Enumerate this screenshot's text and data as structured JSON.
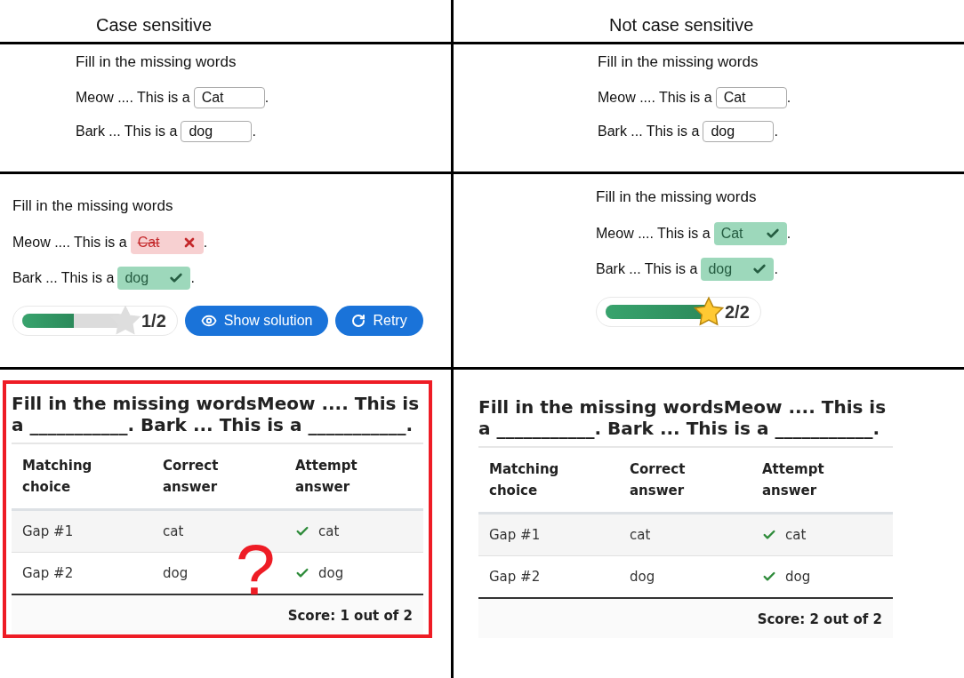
{
  "columns": [
    {
      "heading": "Case sensitive",
      "input_task": {
        "title": "Fill in the missing words",
        "sentences": [
          {
            "text": "Meow .... This is a",
            "value": "Cat",
            "after": "."
          },
          {
            "text": "Bark ... This is a",
            "value": "dog",
            "after": "."
          }
        ]
      },
      "result_task": {
        "title": "Fill in the missing words",
        "sentences": [
          {
            "text": "Meow .... This is a",
            "answer": "Cat",
            "correct": false,
            "after": "."
          },
          {
            "text": "Bark ... This is a",
            "answer": "dog",
            "correct": true,
            "after": "."
          }
        ],
        "progress": {
          "level": 0.5,
          "star_filled": false,
          "score": "1/2"
        },
        "buttons": [
          {
            "label": "Show solution",
            "kind": "solution"
          },
          {
            "label": "Retry",
            "kind": "retry"
          }
        ]
      },
      "report": {
        "highlighted": true,
        "annotation": "?",
        "question": "Fill in the missing wordsMeow .... This is a ___________. Bark ... This is a ___________.",
        "table_columns": [
          "Matching choice",
          "Correct answer",
          "Attempt answer"
        ],
        "rows": [
          {
            "gap": "Gap #1",
            "correct_answer": "cat",
            "attempt": "cat",
            "correct": true
          },
          {
            "gap": "Gap #2",
            "correct_answer": "dog",
            "attempt": "dog",
            "correct": true
          }
        ],
        "score": "Score: 1 out of 2"
      }
    },
    {
      "heading": "Not case sensitive",
      "input_task": {
        "title": "Fill in the missing words",
        "sentences": [
          {
            "text": "Meow .... This is a",
            "value": "Cat",
            "after": "."
          },
          {
            "text": "Bark ... This is a",
            "value": "dog",
            "after": "."
          }
        ]
      },
      "result_task": {
        "title": "Fill in the missing words",
        "sentences": [
          {
            "text": "Meow .... This is a",
            "answer": "Cat",
            "correct": true,
            "after": "."
          },
          {
            "text": "Bark ... This is a",
            "answer": "dog",
            "correct": true,
            "after": "."
          }
        ],
        "progress": {
          "level": 1,
          "star_filled": true,
          "score": "2/2"
        }
      },
      "report": {
        "question": "Fill in the missing wordsMeow .... This is a ___________. Bark ... This is a ___________.",
        "table_columns": [
          "Matching choice",
          "Correct answer",
          "Attempt answer"
        ],
        "rows": [
          {
            "gap": "Gap #1",
            "correct_answer": "cat",
            "attempt": "cat",
            "correct": true
          },
          {
            "gap": "Gap #2",
            "correct_answer": "dog",
            "attempt": "dog",
            "correct": true
          }
        ],
        "score": "Score: 2 out of 2"
      }
    }
  ]
}
